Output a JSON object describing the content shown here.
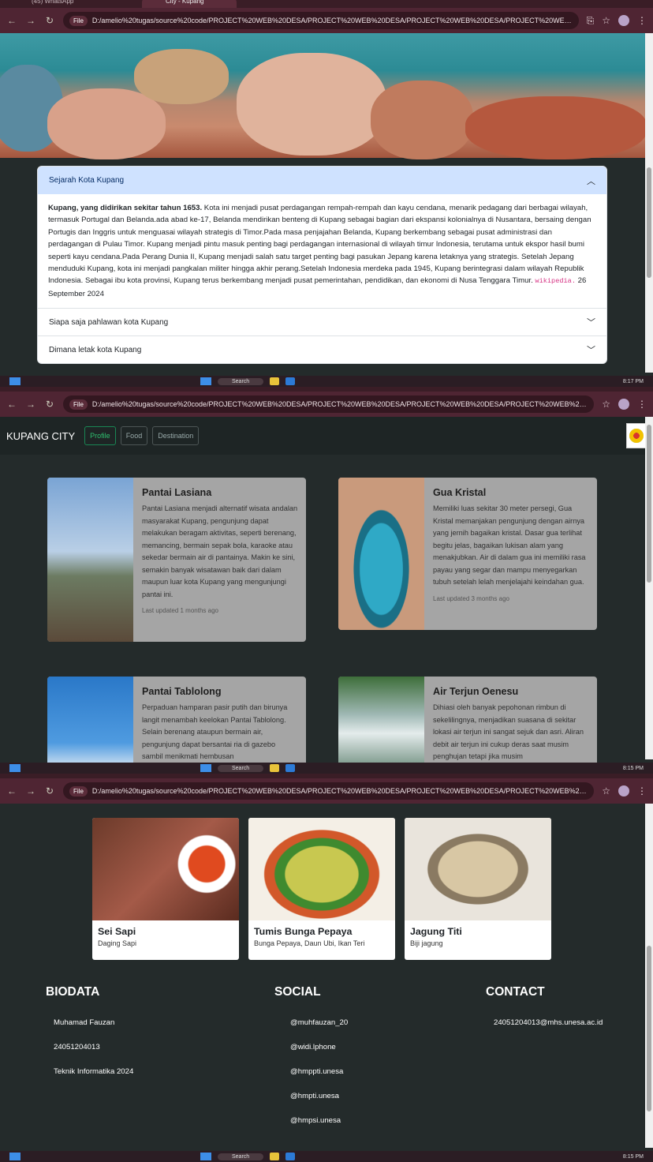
{
  "browser": {
    "tab_whatsapp": "(45) WhatsApp",
    "tab_city": "City - Kupang",
    "file_label": "File",
    "url_1": "D:/amelio%20tugas/source%20code/PROJECT%20WEB%20DESA/PROJECT%20WEB%20DESA/PROJECT%20WEB%20DESA/PROJECT%20WEB%20DESA...",
    "url_2": "D:/amelio%20tugas/source%20code/PROJECT%20WEB%20DESA/PROJECT%20WEB%20DESA/PROJECT%20WEB%20DESA/PROJECT%20WEB%20DESA/DES...",
    "url_3": "D:/amelio%20tugas/source%20code/PROJECT%20WEB%20DESA/PROJECT%20WEB%20DESA/PROJECT%20WEB%20DESA/PROJECT%20WEB%20DESA/FOO..."
  },
  "taskbar": {
    "search": "Search",
    "time_1": "8:17 PM",
    "time_2": "8:15 PM",
    "time_3": "8:15 PM"
  },
  "accordion": {
    "items": [
      {
        "title": "Sejarah Kota Kupang",
        "body_bold": "Kupang, yang didirikan sekitar tahun 1653.",
        "body_text": " Kota ini menjadi pusat perdagangan rempah-rempah dan kayu cendana, menarik pedagang dari berbagai wilayah, termasuk Portugal dan Belanda.ada abad ke-17, Belanda mendirikan benteng di Kupang sebagai bagian dari ekspansi kolonialnya di Nusantara, bersaing dengan Portugis dan Inggris untuk menguasai wilayah strategis di Timor.Pada masa penjajahan Belanda, Kupang berkembang sebagai pusat administrasi dan perdagangan di Pulau Timor. Kupang menjadi pintu masuk penting bagi perdagangan internasional di wilayah timur Indonesia, terutama untuk ekspor hasil bumi seperti kayu cendana.Pada Perang Dunia II, Kupang menjadi salah satu target penting bagi pasukan Jepang karena letaknya yang strategis. Setelah Jepang menduduki Kupang, kota ini menjadi pangkalan militer hingga akhir perang.Setelah Indonesia merdeka pada 1945, Kupang berintegrasi dalam wilayah Republik Indonesia. Sebagai ibu kota provinsi, Kupang terus berkembang menjadi pusat pemerintahan, pendidikan, dan ekonomi di Nusa Tenggara Timur. ",
        "source": "wikipedia.",
        "date": " 26 September 2024"
      },
      {
        "title": "Siapa saja pahlawan kota Kupang"
      },
      {
        "title": "Dimana letak kota Kupang"
      }
    ]
  },
  "navbar": {
    "brand": "KUPANG CITY",
    "links": [
      "Profile",
      "Food",
      "Destination"
    ]
  },
  "destinations": [
    {
      "title": "Pantai Lasiana",
      "text": "Pantai Lasiana menjadi alternatif wisata andalan masyarakat Kupang, pengunjung dapat melakukan beragam aktivitas, seperti berenang, memancing, bermain sepak bola, karaoke atau sekedar bermain air di pantainya. Makin ke sini, semakin banyak wisatawan baik dari dalam maupun luar kota Kupang yang mengunjungi pantai ini.",
      "updated": "Last updated 1 months ago"
    },
    {
      "title": "Gua Kristal",
      "text": "Memiliki luas sekitar 30 meter persegi, Gua Kristal memanjakan pengunjung dengan airnya yang jernih bagaikan kristal. Dasar gua terlihat begitu jelas, bagaikan lukisan alam yang menakjubkan. Air di dalam gua ini memiliki rasa payau yang segar dan mampu menyegarkan tubuh setelah lelah menjelajahi keindahan gua.",
      "updated": "Last updated 3 months ago"
    },
    {
      "title": "Pantai Tablolong",
      "text": "Perpaduan hamparan pasir putih dan birunya langit menambah keelokan Pantai Tablolong. Selain berenang ataupun bermain air, pengunjung dapat bersantai ria di gazebo sambil menikmati hembusan"
    },
    {
      "title": "Air Terjun Oenesu",
      "text": "Dihiasi oleh banyak pepohonan rimbun di sekelilingnya, menjadikan suasana di sekitar lokasi air terjun ini sangat sejuk dan asri. Aliran debit air terjun ini cukup deras saat musim penghujan tetapi jika musim"
    }
  ],
  "foods": [
    {
      "title": "Sei Sapi",
      "desc": "Daging Sapi"
    },
    {
      "title": "Tumis Bunga Pepaya",
      "desc": "Bunga Pepaya, Daun Ubi, Ikan Teri"
    },
    {
      "title": "Jagung Titi",
      "desc": "Biji jagung"
    }
  ],
  "footer": {
    "biodata": {
      "heading": "BIODATA",
      "items": [
        "Muhamad Fauzan",
        "24051204013",
        "Teknik Informatika 2024"
      ]
    },
    "social": {
      "heading": "SOCIAL",
      "items": [
        "@muhfauzan_20",
        "@widi.lphone",
        "@hmppti.unesa",
        "@hmpti.unesa",
        "@hmpsi.unesa"
      ]
    },
    "contact": {
      "heading": "CONTACT",
      "items": [
        "24051204013@mhs.unesa.ac.id"
      ]
    }
  }
}
